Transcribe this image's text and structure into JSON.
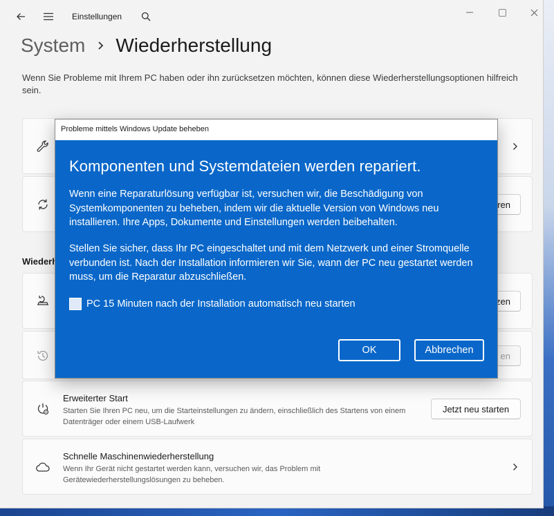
{
  "titlebar": {
    "app_title": "Einstellungen",
    "back_icon": "arrow-left-icon",
    "menu_icon": "hamburger-icon",
    "search_icon": "search-icon",
    "controls": [
      "minimize",
      "maximize",
      "close"
    ]
  },
  "breadcrumb": {
    "parent": "System",
    "separator": "›",
    "current": "Wiederherstellung"
  },
  "intro": "Wenn Sie Probleme mit Ihrem PC haben oder ihn zurücksetzen möchten, können diese Wiederherstellungsoptionen hilfreich sein.",
  "section_label": "Wiederherstellungsoptionen",
  "cards": [
    {
      "icon": "wrench-icon",
      "action": "chevron"
    },
    {
      "icon": "refresh-icon",
      "button_visible": "ren"
    },
    {
      "icon": "reset-pc-icon",
      "button_visible": "zen"
    },
    {
      "icon": "history-icon",
      "button_visible": "en",
      "disabled": true
    },
    {
      "icon": "advanced-startup-icon",
      "title": "Erweiterter Start",
      "description": "Starten Sie Ihren PC neu, um die Starteinstellungen zu ändern, einschließlich des Startens von einem Datenträger oder einem USB-Laufwerk",
      "button": "Jetzt neu starten"
    },
    {
      "icon": "cloud-icon",
      "title": "Schnelle Maschinenwiederherstellung",
      "description": "Wenn Ihr Gerät nicht gestartet werden kann, versuchen wir, das Problem mit Gerätewiederherstellungslösungen zu beheben.",
      "action": "chevron"
    }
  ],
  "dialog": {
    "title": "Probleme mittels Windows Update beheben",
    "heading": "Komponenten und Systemdateien werden repariert.",
    "paragraph1": "Wenn eine Reparaturlösung verfügbar ist, versuchen wir, die Beschädigung von Systemkomponenten zu beheben, indem wir die aktuelle Version von Windows neu installieren. Ihre Apps, Dokumente und Einstellungen werden beibehalten.",
    "paragraph2": "Stellen Sie sicher, dass Ihr PC eingeschaltet und mit dem Netzwerk und einer Stromquelle verbunden ist. Nach der Installation informieren wir Sie, wann der PC neu gestartet werden muss, um die Reparatur abzuschließen.",
    "checkbox_label": "PC 15 Minuten nach der Installation automatisch neu starten",
    "checkbox_checked": false,
    "ok_label": "OK",
    "cancel_label": "Abbrechen",
    "background_color": "#0a67c9"
  }
}
